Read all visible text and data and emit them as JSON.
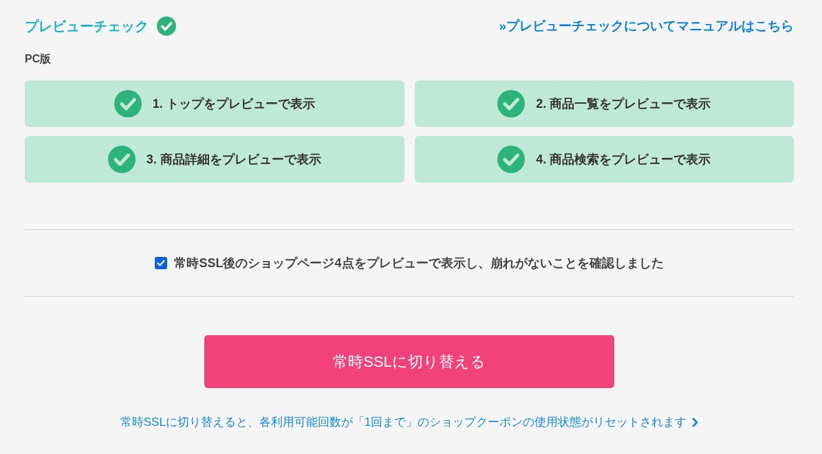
{
  "header": {
    "title": "プレビューチェック",
    "completed": true,
    "manual_link": "»プレビューチェックについてマニュアルはこちら"
  },
  "section": {
    "label": "PC版"
  },
  "checks": [
    {
      "label": "1. トップをプレビューで表示",
      "checked": true
    },
    {
      "label": "2. 商品一覧をプレビューで表示",
      "checked": true
    },
    {
      "label": "3. 商品詳細をプレビューで表示",
      "checked": true
    },
    {
      "label": "4. 商品検索をプレビューで表示",
      "checked": true
    }
  ],
  "confirmation": {
    "label": "常時SSL後のショップページ4点をプレビューで表示し、崩れがないことを確認しました",
    "checked": true
  },
  "switch_button": {
    "label": "常時SSLに切り替える"
  },
  "notice_link": {
    "label": "常時SSLに切り替えると、各利用可能回数が「1回まで」のショップクーポンの使用状態がリセットされます"
  }
}
